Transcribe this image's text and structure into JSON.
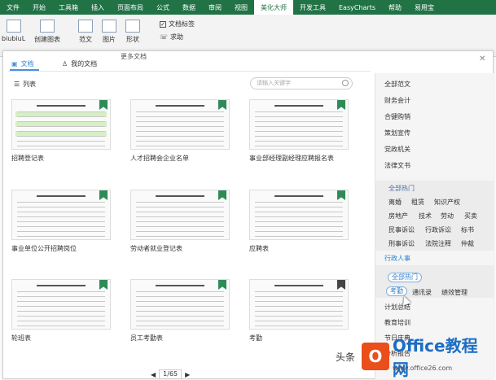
{
  "ribbon_tabs": [
    "文件",
    "开始",
    "工具箱",
    "插入",
    "页面布局",
    "公式",
    "数据",
    "审阅",
    "视图",
    "美化大师",
    "开发工具",
    "EasyCharts",
    "帮助",
    "易用宝"
  ],
  "ribbon_active": "美化大师",
  "ribbon": {
    "biubiu": "biubiuL",
    "create_chart": "创建图表",
    "fanwen": "范文",
    "image": "图片",
    "shape": "形状",
    "doc_tag": "文档标签",
    "help": "求助",
    "more_docs": "更多文档"
  },
  "panel": {
    "tab_doc": "文档",
    "tab_my_doc": "我的文档",
    "list_label": "列表",
    "search_placeholder": "请输入关键字"
  },
  "cards": [
    {
      "caption": "招聘登记表",
      "bookmark": "green"
    },
    {
      "caption": "人才招聘会企业名单",
      "bookmark": "green"
    },
    {
      "caption": "事业部经理副经理应聘报名表",
      "bookmark": "green"
    },
    {
      "caption": "事业单位公开招聘岗位",
      "bookmark": "green"
    },
    {
      "caption": "劳动者就业登记表",
      "bookmark": "green"
    },
    {
      "caption": "应聘表",
      "bookmark": "green"
    },
    {
      "caption": "轮班表",
      "bookmark": "green"
    },
    {
      "caption": "员工考勤表",
      "bookmark": "green"
    },
    {
      "caption": "考勤",
      "bookmark": "dark"
    }
  ],
  "sidebar": {
    "categories": [
      "全部范文",
      "财务会计",
      "合键购销",
      "策划宣传",
      "党政机关",
      "法律文书"
    ],
    "law_sub": {
      "all_hot": "全部热门",
      "row1": [
        "离婚",
        "租赁",
        "知识产权"
      ],
      "row2": [
        "房地产",
        "技术",
        "劳动",
        "买卖"
      ],
      "row3": [
        "民事诉讼",
        "行政诉讼",
        "标书"
      ],
      "row4": [
        "刑事诉讼",
        "法院注释",
        "仲裁"
      ]
    },
    "admin": "行政人事",
    "admin_sub": {
      "all_hot": "全部热门",
      "row1": [
        "考勤",
        "通讯录",
        "绩效管理"
      ]
    },
    "more": [
      "计划总结",
      "教育培训",
      "节日庆典",
      "分析报告"
    ]
  },
  "pager": {
    "current": "1/65"
  },
  "watermark": {
    "prefix": "头条",
    "brand": "Office教程网",
    "url": "www.office26.com"
  }
}
